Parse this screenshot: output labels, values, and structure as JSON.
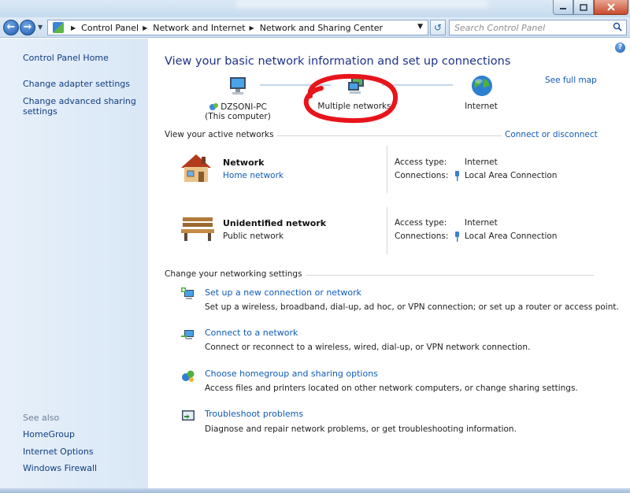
{
  "window": {
    "minimize_icon": "minimize-icon",
    "maximize_icon": "maximize-icon",
    "close_icon": "close-icon"
  },
  "address": {
    "crumbs": [
      "Control Panel",
      "Network and Internet",
      "Network and Sharing Center"
    ],
    "search_placeholder": "Search Control Panel"
  },
  "sidebar": {
    "home": "Control Panel Home",
    "links": [
      "Change adapter settings",
      "Change advanced sharing settings"
    ],
    "see_also_title": "See also",
    "see_also": [
      "HomeGroup",
      "Internet Options",
      "Windows Firewall"
    ]
  },
  "main": {
    "title": "View your basic network information and set up connections",
    "see_full_map": "See full map",
    "map": {
      "computer_name": "DZSONI-PC",
      "computer_sub": "(This computer)",
      "middle": "Multiple networks",
      "internet": "Internet"
    },
    "active_header": "View your active networks",
    "connect_disconnect": "Connect or disconnect",
    "networks": [
      {
        "name": "Network",
        "type": "Home network",
        "access_label": "Access type:",
        "access_value": "Internet",
        "conn_label": "Connections:",
        "conn_value": "Local Area Connection"
      },
      {
        "name": "Unidentified network",
        "type": "Public network",
        "access_label": "Access type:",
        "access_value": "Internet",
        "conn_label": "Connections:",
        "conn_value": "Local Area Connection"
      }
    ],
    "settings_header": "Change your networking settings",
    "tasks": [
      {
        "title": "Set up a new connection or network",
        "desc": "Set up a wireless, broadband, dial-up, ad hoc, or VPN connection; or set up a router or access point."
      },
      {
        "title": "Connect to a network",
        "desc": "Connect or reconnect to a wireless, wired, dial-up, or VPN network connection."
      },
      {
        "title": "Choose homegroup and sharing options",
        "desc": "Access files and printers located on other network computers, or change sharing settings."
      },
      {
        "title": "Troubleshoot problems",
        "desc": "Diagnose and repair network problems, or get troubleshooting information."
      }
    ]
  },
  "colors": {
    "link": "#0f5bb5",
    "title": "#1e3287",
    "annotation": "#e8141b"
  }
}
